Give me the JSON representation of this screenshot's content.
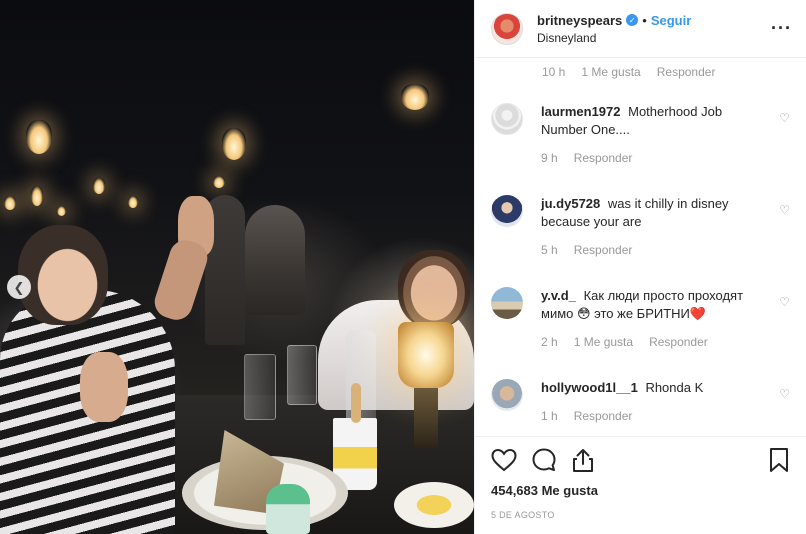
{
  "post": {
    "username": "britneyspears",
    "verified_icon": "verified-badge-icon",
    "separator": "•",
    "follow_label": "Seguir",
    "location": "Disneyland",
    "more_icon": "more-options-icon"
  },
  "caption_meta": {
    "time": "10 h",
    "likes": "1 Me gusta",
    "reply": "Responder"
  },
  "comments": [
    {
      "user": "laurmen1972",
      "text": "Motherhood Job Number One....",
      "time": "9 h",
      "likes": "",
      "reply": "Responder"
    },
    {
      "user": "ju.dy5728",
      "text": "was it chilly in disney because your are",
      "time": "5 h",
      "likes": "",
      "reply": "Responder"
    },
    {
      "user": "y.v.d_",
      "text": "Как люди просто проходят мимо 😳 это же БРИТНИ❤️",
      "time": "2 h",
      "likes": "1 Me gusta",
      "reply": "Responder"
    },
    {
      "user": "hollywood1l__1",
      "text": "Rhonda K",
      "time": "1 h",
      "likes": "",
      "reply": "Responder"
    }
  ],
  "actions": {
    "like_icon": "heart-icon",
    "comment_icon": "comment-icon",
    "share_icon": "share-icon",
    "save_icon": "bookmark-icon"
  },
  "likes_count": "454,683 Me gusta",
  "date": "5 DE AGOSTO",
  "carousel_prev_icon": "chevron-left-icon",
  "colors": {
    "accent": "#3897f0",
    "muted": "#999999",
    "text": "#262626"
  }
}
